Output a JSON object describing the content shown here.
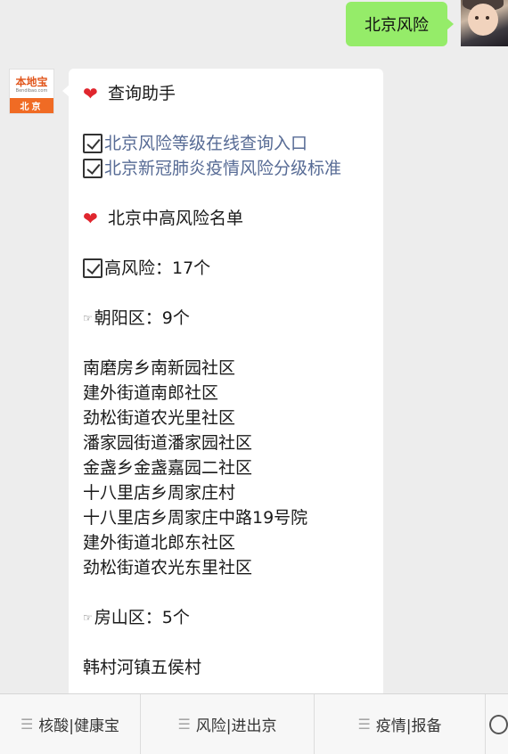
{
  "outgoing": {
    "text": "北京风险"
  },
  "bot": {
    "logo_text": "本地宝",
    "logo_url": "Bendibao.com",
    "logo_city": "北京"
  },
  "message": {
    "heading1": "查询助手",
    "link1": "北京风险等级在线查询入口",
    "link2": "北京新冠肺炎疫情风险分级标准",
    "heading2": "北京中高风险名单",
    "high_risk": "高风险：17个",
    "district1": "朝阳区：9个",
    "district1_items": [
      "南磨房乡南新园社区",
      "建外街道南郎社区",
      "劲松街道农光里社区",
      "潘家园街道潘家园社区",
      "金盏乡金盏嘉园二社区",
      "十八里店乡周家庄村",
      "十八里店乡周家庄中路19号院",
      "建外街道北郎东社区",
      "劲松街道农光东里社区"
    ],
    "district2": "房山区：5个",
    "district2_items": [
      "韩村河镇五侯村"
    ]
  },
  "menu": {
    "items": [
      "核酸|健康宝",
      "风险|进出京",
      "疫情|报备"
    ]
  },
  "colors": {
    "bubble_out": "#95ec69",
    "link": "#576b95",
    "heart": "#e0262e",
    "logo_orange": "#f06b24"
  }
}
